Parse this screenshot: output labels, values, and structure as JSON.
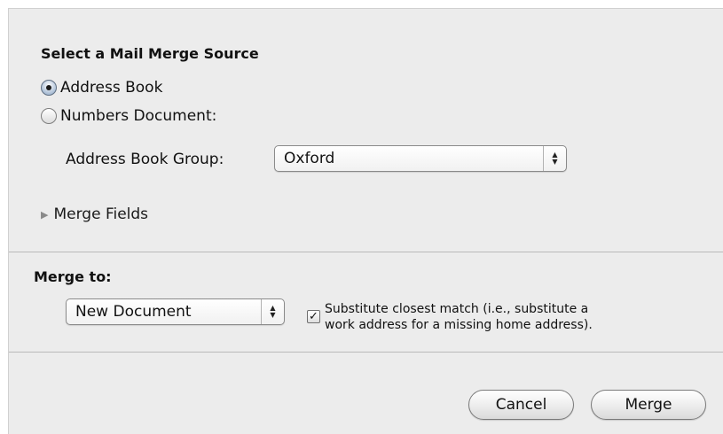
{
  "source": {
    "heading": "Select a Mail Merge Source",
    "options": [
      {
        "label": "Address Book",
        "selected": true
      },
      {
        "label": "Numbers Document:",
        "selected": false
      }
    ],
    "group_label": "Address Book Group:",
    "group_value": "Oxford",
    "merge_fields_label": "Merge Fields"
  },
  "merge_to": {
    "heading": "Merge to:",
    "target_value": "New Document",
    "substitute_checked": true,
    "substitute_line1": "Substitute closest match (i.e., substitute a",
    "substitute_line2": "work address for a missing home address)."
  },
  "buttons": {
    "cancel": "Cancel",
    "merge": "Merge"
  },
  "icons": {
    "stepper": "up-down-arrows-icon",
    "disclosure": "disclosure-triangle-icon",
    "checkmark": "checkmark-icon"
  }
}
